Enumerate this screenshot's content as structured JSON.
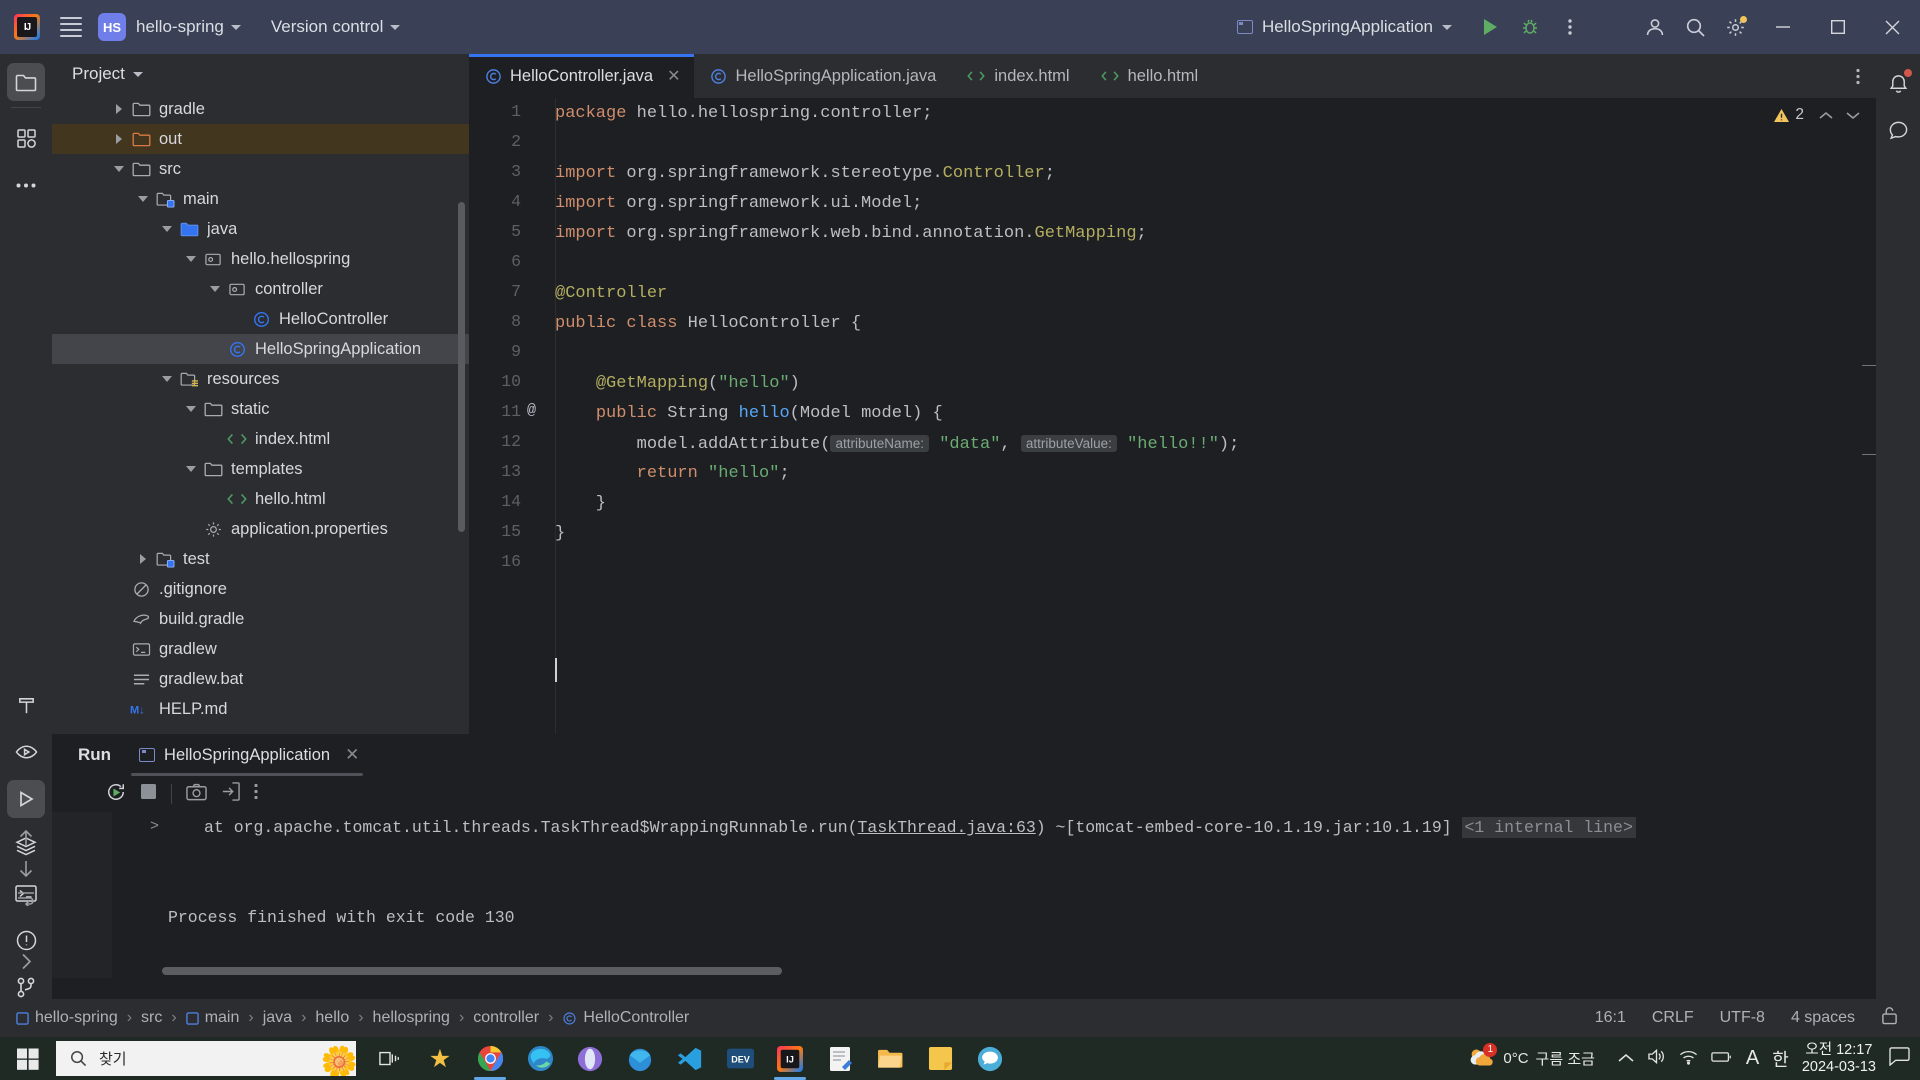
{
  "titlebar": {
    "app_icon": "intellij-logo",
    "menu_icon": "hamburger-menu-icon",
    "project_badge": "HS",
    "project_name": "hello-spring",
    "version_control": "Version control",
    "run_config": "HelloSpringApplication",
    "run_icon": "run-play-icon",
    "debug_icon": "debug-bug-icon",
    "more_icon": "more-vertical-icon",
    "account_icon": "account-icon",
    "search_icon": "search-everywhere-icon",
    "settings_icon": "settings-gear-icon",
    "minimize": "minimize-icon",
    "maximize": "maximize-icon",
    "close": "close-icon",
    "accent": "#3573F0",
    "bg": "#3A4055"
  },
  "rail": {
    "top": [
      {
        "name": "project-tool-window",
        "icon": "folder-icon",
        "active": true
      },
      {
        "name": "commit-tool-window",
        "icon": "structure-blocks-icon",
        "active": false
      },
      {
        "name": "more-tool-windows",
        "icon": "ellipsis-icon",
        "active": false
      }
    ],
    "bottom": [
      {
        "name": "build-tool-window",
        "icon": "hammer-icon",
        "active": false
      },
      {
        "name": "run-anything",
        "icon": "eye-run-icon",
        "active": false
      },
      {
        "name": "run-tool-window",
        "icon": "play-icon",
        "active": true
      },
      {
        "name": "services-tool-window",
        "icon": "layers-icon",
        "active": false
      },
      {
        "name": "terminal-tool-window",
        "icon": "terminal-icon",
        "active": false
      },
      {
        "name": "problems-tool-window",
        "icon": "warning-circle-icon",
        "active": false
      },
      {
        "name": "version-control-tool-window",
        "icon": "branch-icon",
        "active": false
      }
    ]
  },
  "project_panel": {
    "title": "Project",
    "tree": [
      {
        "label": "gradle",
        "depth": 2,
        "twisty": "right",
        "icon": "folder",
        "state": "normal"
      },
      {
        "label": "out",
        "depth": 2,
        "twisty": "right",
        "icon": "folder-excluded",
        "state": "excluded"
      },
      {
        "label": "src",
        "depth": 2,
        "twisty": "down",
        "icon": "folder",
        "state": "normal"
      },
      {
        "label": "main",
        "depth": 3,
        "twisty": "down",
        "icon": "folder-module",
        "state": "normal"
      },
      {
        "label": "java",
        "depth": 4,
        "twisty": "down",
        "icon": "folder-source",
        "state": "normal"
      },
      {
        "label": "hello.hellospring",
        "depth": 5,
        "twisty": "down",
        "icon": "package",
        "state": "normal"
      },
      {
        "label": "controller",
        "depth": 6,
        "twisty": "down",
        "icon": "package",
        "state": "normal"
      },
      {
        "label": "HelloController",
        "depth": 7,
        "twisty": "none",
        "icon": "java-class",
        "state": "normal"
      },
      {
        "label": "HelloSpringApplication",
        "depth": 6,
        "twisty": "none",
        "icon": "java-class",
        "state": "selected"
      },
      {
        "label": "resources",
        "depth": 4,
        "twisty": "down",
        "icon": "folder-resources",
        "state": "normal"
      },
      {
        "label": "static",
        "depth": 5,
        "twisty": "down",
        "icon": "folder",
        "state": "normal"
      },
      {
        "label": "index.html",
        "depth": 6,
        "twisty": "none",
        "icon": "html",
        "state": "normal"
      },
      {
        "label": "templates",
        "depth": 5,
        "twisty": "down",
        "icon": "folder",
        "state": "normal"
      },
      {
        "label": "hello.html",
        "depth": 6,
        "twisty": "none",
        "icon": "html",
        "state": "normal"
      },
      {
        "label": "application.properties",
        "depth": 5,
        "twisty": "none",
        "icon": "properties",
        "state": "normal"
      },
      {
        "label": "test",
        "depth": 3,
        "twisty": "right",
        "icon": "folder-module",
        "state": "normal"
      },
      {
        "label": ".gitignore",
        "depth": 2,
        "twisty": "none",
        "icon": "gitignore",
        "state": "normal"
      },
      {
        "label": "build.gradle",
        "depth": 2,
        "twisty": "none",
        "icon": "gradle",
        "state": "normal"
      },
      {
        "label": "gradlew",
        "depth": 2,
        "twisty": "none",
        "icon": "shell",
        "state": "normal"
      },
      {
        "label": "gradlew.bat",
        "depth": 2,
        "twisty": "none",
        "icon": "text-file",
        "state": "normal"
      },
      {
        "label": "HELP.md",
        "depth": 2,
        "twisty": "none",
        "icon": "markdown",
        "state": "normal"
      }
    ]
  },
  "editor": {
    "tabs": [
      {
        "label": "HelloController.java",
        "icon": "java-class",
        "active": true,
        "closeable": true
      },
      {
        "label": "HelloSpringApplication.java",
        "icon": "java-class",
        "active": false,
        "closeable": false
      },
      {
        "label": "index.html",
        "icon": "html",
        "active": false,
        "closeable": false
      },
      {
        "label": "hello.html",
        "icon": "html",
        "active": false,
        "closeable": false
      }
    ],
    "more_icon": "more-vertical-icon",
    "warning_count": "2",
    "warning_icon": "warning-triangle-icon",
    "up_icon": "chevron-up-icon",
    "down_icon": "chevron-down-icon",
    "line_numbers": [
      "1",
      "2",
      "3",
      "4",
      "5",
      "6",
      "7",
      "8",
      "9",
      "10",
      "11",
      "12",
      "13",
      "14",
      "15",
      "16"
    ],
    "gutter_mark_line": 11,
    "gutter_mark": "@",
    "lines": [
      {
        "n": 1,
        "html": "<span class=\"kw\">package</span> hello.hellospring.controller;"
      },
      {
        "n": 2,
        "html": ""
      },
      {
        "n": 3,
        "html": "<span class=\"kw\">import</span> org.springframework.stereotype.<span class=\"ann\">Controller</span>;"
      },
      {
        "n": 4,
        "html": "<span class=\"kw\">import</span> org.springframework.ui.Model;"
      },
      {
        "n": 5,
        "html": "<span class=\"kw\">import</span> org.springframework.web.bind.annotation.<span class=\"ann\">GetMapping</span>;"
      },
      {
        "n": 6,
        "html": ""
      },
      {
        "n": 7,
        "html": "<span class=\"ann\">@Controller</span>"
      },
      {
        "n": 8,
        "html": "<span class=\"kw\">public class</span> <span class=\"cls\">HelloController</span> {"
      },
      {
        "n": 9,
        "html": ""
      },
      {
        "n": 10,
        "html": "    <span class=\"ann\">@GetMapping</span>(<span class=\"str\">\"hello\"</span>)"
      },
      {
        "n": 11,
        "html": "    <span class=\"kw\">public</span> String <span class=\"mth\">hello</span>(Model model) {"
      },
      {
        "n": 12,
        "html": "        model.addAttribute(<span class=\"hint\">attributeName:</span> <span class=\"str\">\"data\"</span>, <span class=\"hint\">attributeValue:</span> <span class=\"str\">\"hello!!\"</span>);"
      },
      {
        "n": 13,
        "html": "        <span class=\"kw\">return</span> <span class=\"str\">\"hello\"</span>;"
      },
      {
        "n": 14,
        "html": "    }"
      },
      {
        "n": 15,
        "html": "}"
      },
      {
        "n": 16,
        "html": ""
      }
    ]
  },
  "run_panel": {
    "title": "Run",
    "tab_label": "HelloSpringApplication",
    "tab_icon": "run-config-icon",
    "tab_close": "close-icon",
    "toolbar": [
      {
        "name": "rerun-button",
        "icon": "rerun-icon"
      },
      {
        "name": "stop-button",
        "icon": "stop-square-icon"
      },
      {
        "name": "screenshot-button",
        "icon": "camera-icon"
      },
      {
        "name": "print-button",
        "icon": "export-icon"
      },
      {
        "name": "more-button",
        "icon": "more-vertical-icon"
      }
    ],
    "side_buttons": [
      {
        "name": "scroll-up-button",
        "icon": "arrow-up-icon"
      },
      {
        "name": "scroll-down-button",
        "icon": "arrow-down-icon"
      },
      {
        "name": "soft-wrap-button",
        "icon": "wrap-lines-icon"
      },
      {
        "name": "expand-button",
        "icon": "chevron-right-icon"
      }
    ],
    "console": {
      "fold_marker": ">",
      "line1_prefix": "at org.apache.tomcat.util.threads.TaskThread$WrappingRunnable.run(",
      "line1_link": "TaskThread.java:63",
      "line1_mid": ") ~[tomcat-embed-core-10.1.19.jar:10.1.19] ",
      "line1_dim": "<1 internal line>",
      "line2": "Process finished with exit code 130"
    }
  },
  "status_bar": {
    "breadcrumbs": [
      {
        "label": "hello-spring",
        "icon": "module-icon"
      },
      {
        "label": "src",
        "icon": "none"
      },
      {
        "label": "main",
        "icon": "module-icon"
      },
      {
        "label": "java",
        "icon": "none"
      },
      {
        "label": "hello",
        "icon": "none"
      },
      {
        "label": "hellospring",
        "icon": "none"
      },
      {
        "label": "controller",
        "icon": "none"
      },
      {
        "label": "HelloController",
        "icon": "java-class"
      }
    ],
    "separator": "›",
    "caret_position": "16:1",
    "line_separator": "CRLF",
    "encoding": "UTF-8",
    "indent": "4 spaces",
    "lock_icon": "unlocked-icon"
  },
  "taskbar": {
    "start_icon": "windows-start-icon",
    "search_placeholder": "찾기",
    "search_icon": "search-icon",
    "task_view_icon": "task-view-icon",
    "apps": [
      {
        "name": "star-app-icon",
        "running": false
      },
      {
        "name": "google-chrome-icon",
        "running": true
      },
      {
        "name": "microsoft-edge-icon",
        "running": false
      },
      {
        "name": "opera-browser-icon",
        "running": false
      },
      {
        "name": "thunderbird-mail-icon",
        "running": false
      },
      {
        "name": "vs-code-icon",
        "running": false
      },
      {
        "name": "dev-app-icon",
        "running": false
      },
      {
        "name": "intellij-idea-icon",
        "running": true
      },
      {
        "name": "notepad-icon",
        "running": false
      },
      {
        "name": "file-explorer-icon",
        "running": false
      },
      {
        "name": "sticky-notes-icon",
        "running": false
      },
      {
        "name": "kakaotalk-icon",
        "running": false
      }
    ],
    "weather_temp": "0°C",
    "weather_desc": "구름 조금",
    "weather_icon": "cloud-sun-icon",
    "weather_badge": "1",
    "tray": [
      {
        "name": "show-hidden-icons",
        "icon": "chevron-up-icon"
      },
      {
        "name": "volume-icon",
        "icon": "speaker-icon"
      },
      {
        "name": "network-icon",
        "icon": "wifi-icon"
      },
      {
        "name": "battery-icon",
        "icon": "battery-icon"
      },
      {
        "name": "ime-language-icon",
        "icon": "letter-a-icon"
      },
      {
        "name": "ime-mode-icon",
        "icon": "korean-ime-icon"
      }
    ],
    "time": "오전 12:17",
    "date": "2024-03-13",
    "notification_icon": "notification-bubble-icon"
  }
}
